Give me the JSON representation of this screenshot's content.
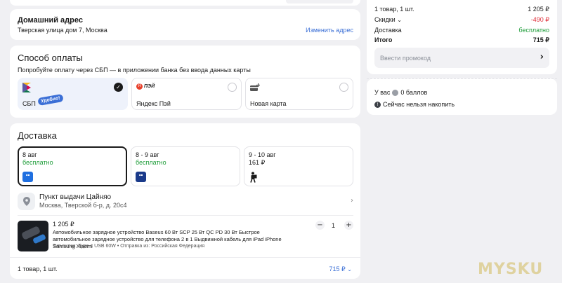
{
  "address": {
    "title": "Домашний адрес",
    "value": "Тверская улица дом 7, Москва",
    "change_link": "Изменить адрес"
  },
  "payment": {
    "title": "Способ оплаты",
    "hint": "Попробуйте оплату через СБП — в приложении банка без ввода данных карты",
    "options": [
      {
        "label": "СБП",
        "badge": "Удобно!",
        "logo": "sbp-logo",
        "selected": true
      },
      {
        "label": "Яндекс Пэй",
        "logo_text": "ПЭЙ",
        "selected": false
      },
      {
        "label": "Новая карта",
        "logo": "card-plus-icon",
        "selected": false
      }
    ]
  },
  "delivery": {
    "title": "Доставка",
    "options": [
      {
        "date": "8 авг",
        "price": "бесплатно",
        "free": true,
        "selected": true
      },
      {
        "date": "8 - 9 авг",
        "price": "бесплатно",
        "free": true,
        "selected": false
      },
      {
        "date": "9 - 10 авг",
        "price": "161 ₽",
        "free": false,
        "selected": false
      }
    ],
    "pickup": {
      "title": "Пункт выдачи Цайняо",
      "address": "Москва, Тверской б-р, д. 20с4"
    },
    "item": {
      "price": "1 205 ₽",
      "name": "Автомобильное зарядное устройство Baseus 60 Вт SCP 25 Вт QC PD 30 Вт Быстрое автомобильное зарядное устройство для телефона 2 в 1 Выдвижной кабель для iPad iPhone Samsung Xiaomi",
      "specs": "Тип вилки: Type-c USB 60W • Отправка из: Российская Федерация",
      "quantity": "1"
    },
    "footer_count": "1 товар, 1 шт.",
    "footer_total": "715 ₽"
  },
  "summary": {
    "items_label": "1 товар, 1 шт.",
    "items_value": "1 205 ₽",
    "discounts_label": "Скидки",
    "discounts_value": "-490 ₽",
    "delivery_label": "Доставка",
    "delivery_value": "бесплатно",
    "total_label": "Итого",
    "total_value": "715 ₽",
    "promo_placeholder": "Ввести промокод"
  },
  "points": {
    "prefix": "У вас",
    "balance": "0 баллов",
    "note": "Сейчас нельзя накопить"
  },
  "watermark": "MYSKU",
  "colors": {
    "accent": "#3b6fd6",
    "green": "#1f9d3a",
    "red": "#e0303b"
  }
}
